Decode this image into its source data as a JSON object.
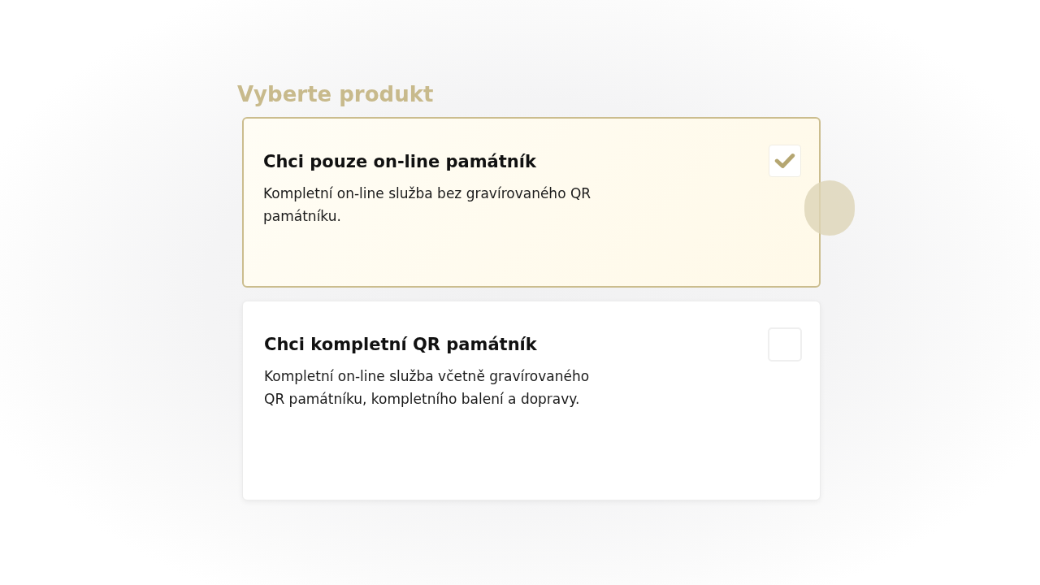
{
  "heading": "Vyberte produkt",
  "options": [
    {
      "title": "Chci pouze on-line památník",
      "description": "Kompletní on-line služba bez gravírovaného QR památníku.",
      "selected": true
    },
    {
      "title": "Chci kompletní QR památník",
      "description": "Kompletní on-line služba včetně gravírovaného QR památníku, kompletního balení a dopravy.",
      "selected": false
    }
  ]
}
